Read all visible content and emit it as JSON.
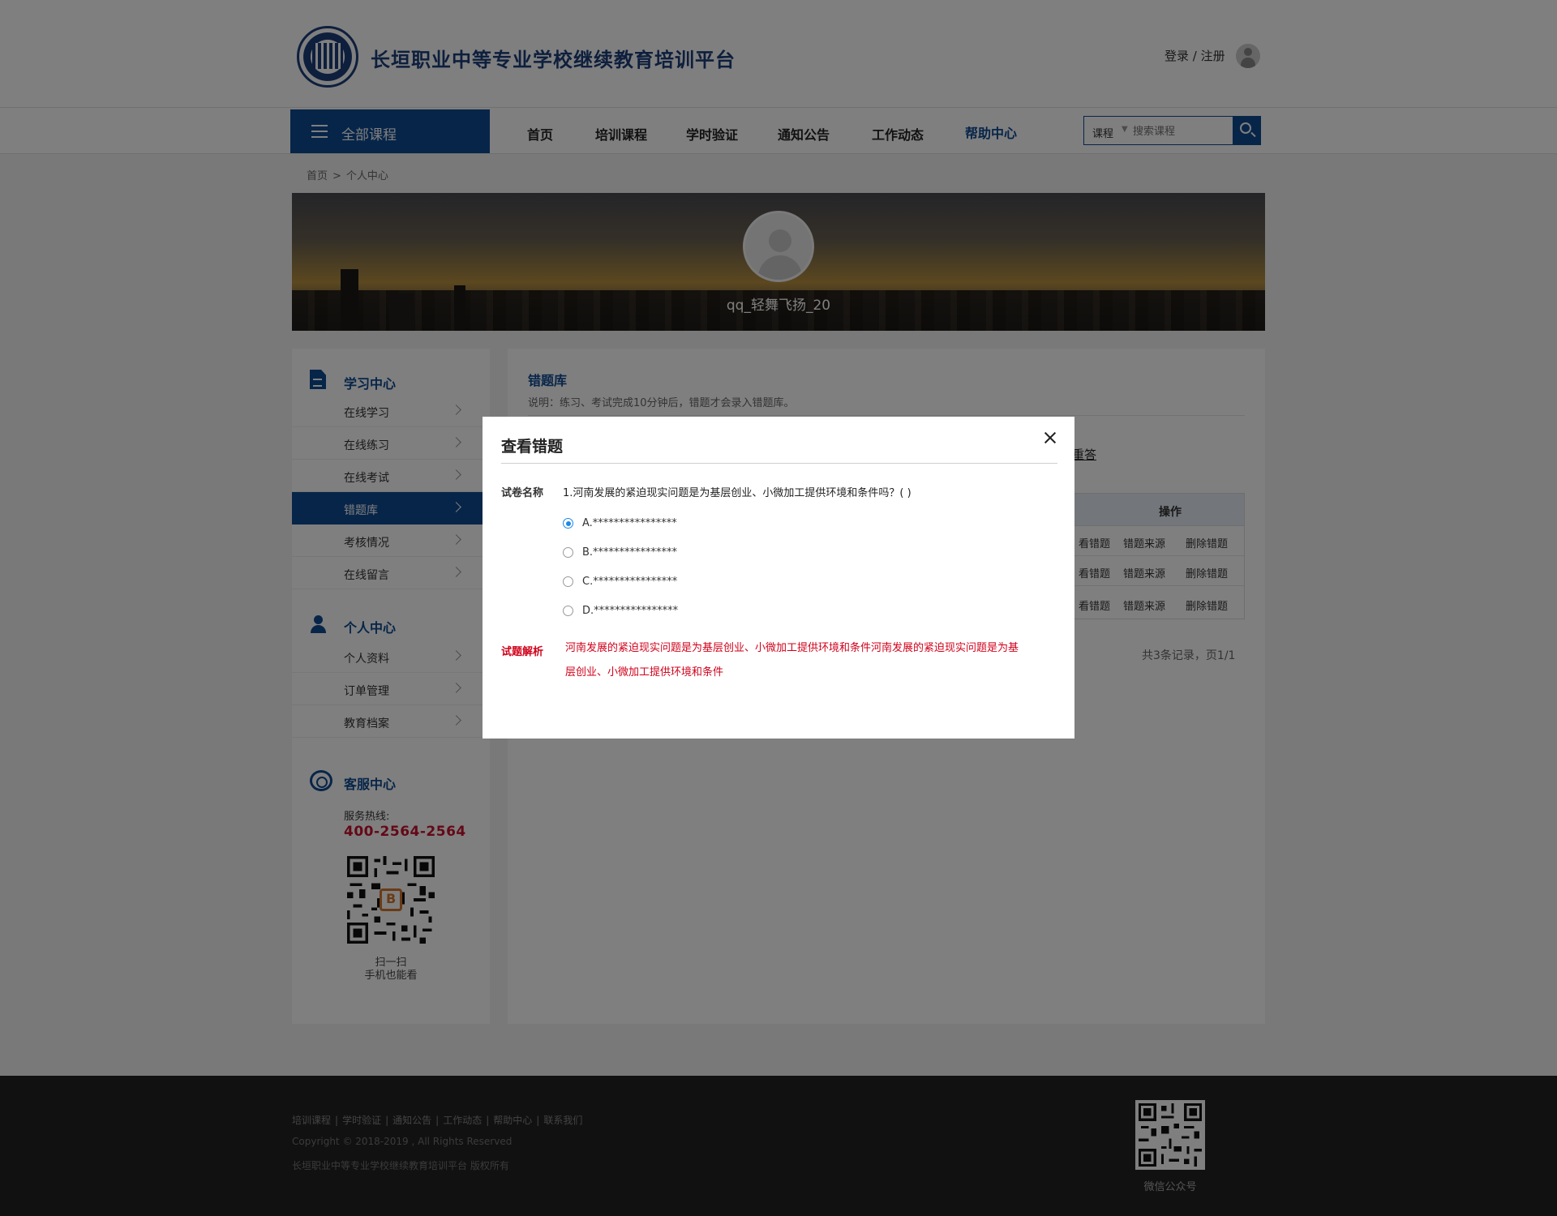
{
  "header": {
    "site_title": "长垣职业中等专业学校继续教育培训平台",
    "login_label": "登录 / 注册"
  },
  "nav": {
    "all_courses": "全部课程",
    "items": [
      "首页",
      "培训课程",
      "学时验证",
      "通知公告",
      "工作动态",
      "帮助中心"
    ],
    "active": "帮助中心",
    "search": {
      "category": "课程",
      "placeholder": "搜索课程"
    }
  },
  "breadcrumb": [
    "首页",
    "个人中心"
  ],
  "profile": {
    "username": "qq_轻舞飞扬_20"
  },
  "sidebar": {
    "learning": {
      "title": "学习中心",
      "items": [
        "在线学习",
        "在线练习",
        "在线考试",
        "错题库",
        "考核情况",
        "在线留言"
      ]
    },
    "personal": {
      "title": "个人中心",
      "items": [
        "个人资料",
        "订单管理",
        "教育档案"
      ]
    },
    "service": {
      "title": "客服中心",
      "hotline_label": "服务热线:",
      "hotline": "400-2564-2564",
      "scan_line1": "扫一扫",
      "scan_line2": "手机也能看"
    }
  },
  "main": {
    "title": "错题库",
    "note": "说明：练习、考试完成10分钟后，错题才会录入错题库。",
    "redo_label": "重答",
    "table": {
      "op_header": "操作",
      "rows": [
        [
          "查看错题",
          "错题来源",
          "删除错题"
        ],
        [
          "查看错题",
          "错题来源",
          "删除错题"
        ],
        [
          "查看错题",
          "错题来源",
          "删除错题"
        ]
      ],
      "visible_row_actions": [
        "看错题",
        "错题来源",
        "删除错题"
      ]
    },
    "pager": "共3条记录，页1/1"
  },
  "modal": {
    "title": "查看错题",
    "question_label": "试卷名称",
    "question": "1.河南发展的紧迫现实问题是为基层创业、小微加工提供环境和条件吗？(        )",
    "options": [
      "A.****************",
      "B.****************",
      "C.****************",
      "D.****************"
    ],
    "selected_option": 0,
    "analysis_label": "试题解析",
    "analysis": "河南发展的紧迫现实问题是为基层创业、小微加工提供环境和条件河南发展的紧迫现实问题是为基层创业、小微加工提供环境和条件"
  },
  "footer": {
    "links": [
      "培训课程",
      "学时验证",
      "通知公告",
      "工作动态",
      "帮助中心",
      "联系我们"
    ],
    "copyright": "Copyright © 2018-2019 , All Rights Reserved",
    "org": "长垣职业中等专业学校继续教育培训平台  版权所有",
    "qr_label": "微信公众号"
  },
  "colors": {
    "brand": "#0f4a93",
    "accent_red": "#c8102e",
    "analysis_red": "#d0021b"
  },
  "icons": [
    "logo-emblem",
    "user-avatar-icon",
    "menu-icon",
    "search-icon",
    "document-icon",
    "person-icon",
    "headset-icon",
    "chevron-right-icon",
    "close-icon",
    "qr-code"
  ]
}
